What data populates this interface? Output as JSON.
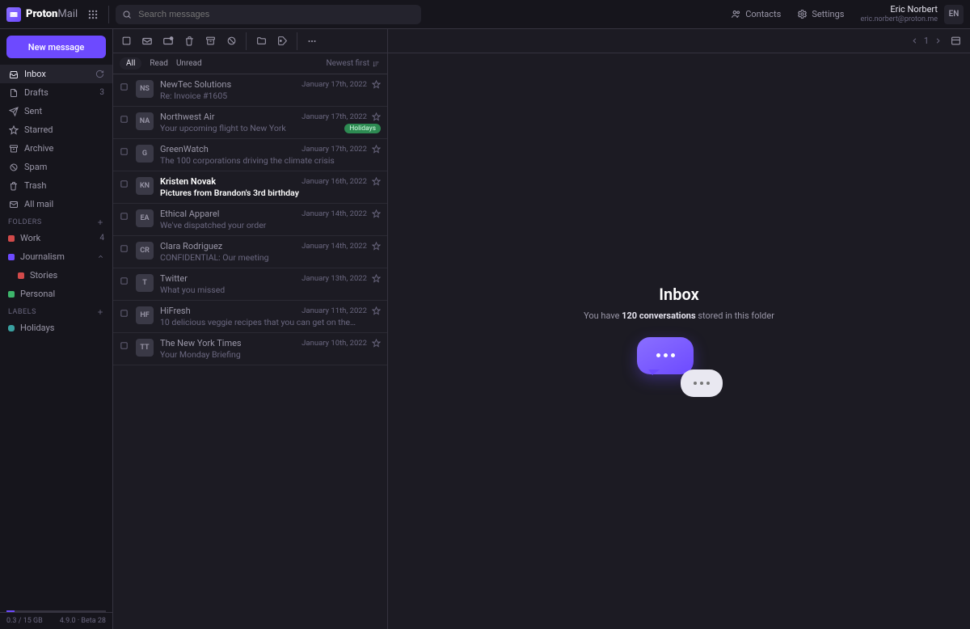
{
  "brand": {
    "name_bold": "Proton",
    "name_light": "Mail"
  },
  "search": {
    "placeholder": "Search messages"
  },
  "top_links": {
    "contacts": "Contacts",
    "settings": "Settings"
  },
  "user": {
    "name": "Eric Norbert",
    "email": "eric.norbert@proton.me",
    "initials": "EN"
  },
  "compose_label": "New message",
  "nav": [
    {
      "icon": "inbox",
      "label": "Inbox",
      "active": true,
      "badge": ""
    },
    {
      "icon": "file",
      "label": "Drafts",
      "badge": "3"
    },
    {
      "icon": "send",
      "label": "Sent"
    },
    {
      "icon": "star",
      "label": "Starred"
    },
    {
      "icon": "archive",
      "label": "Archive"
    },
    {
      "icon": "spam",
      "label": "Spam"
    },
    {
      "icon": "trash",
      "label": "Trash"
    },
    {
      "icon": "mail",
      "label": "All mail"
    }
  ],
  "folders_header": "Folders",
  "folders": [
    {
      "label": "Work",
      "color": "#d14a4a",
      "count": "4"
    },
    {
      "label": "Journalism",
      "color": "#6d4aff",
      "expandable": true
    },
    {
      "label": "Stories",
      "color": "#d14a4a",
      "child": true
    },
    {
      "label": "Personal",
      "color": "#3db56b"
    }
  ],
  "labels_header": "Labels",
  "labels": [
    {
      "label": "Holidays",
      "color": "#39a0a0"
    }
  ],
  "storage": {
    "used": "0.3",
    "total": "15 GB",
    "version": "4.9.0 · Beta 28"
  },
  "filters": {
    "all": "All",
    "read": "Read",
    "unread": "Unread",
    "sort": "Newest first"
  },
  "pagination": {
    "page": "1"
  },
  "pane": {
    "title": "Inbox",
    "sub_pre": "You have ",
    "count": "120 conversations",
    "sub_post": " stored in this folder"
  },
  "messages": [
    {
      "initials": "NS",
      "from": "NewTec Solutions",
      "subject": "Re: Invoice #1605",
      "date": "January 17th, 2022",
      "unread": false
    },
    {
      "initials": "NA",
      "from": "Northwest Air",
      "subject": "Your upcoming flight to New York",
      "date": "January 17th, 2022",
      "unread": false,
      "tag": "Holidays"
    },
    {
      "initials": "G",
      "from": "GreenWatch",
      "subject": "The 100 corporations driving the climate crisis",
      "date": "January 17th, 2022",
      "unread": false
    },
    {
      "initials": "KN",
      "from": "Kristen Novak",
      "subject": "Pictures from Brandon's 3rd birthday",
      "date": "January 16th, 2022",
      "unread": true
    },
    {
      "initials": "EA",
      "from": "Ethical Apparel",
      "subject": "We've dispatched your order",
      "date": "January 14th, 2022",
      "unread": false
    },
    {
      "initials": "CR",
      "from": "Clara Rodriguez",
      "subject": "CONFIDENTIAL: Our meeting",
      "date": "January 14th, 2022",
      "unread": false
    },
    {
      "initials": "T",
      "from": "Twitter",
      "subject": "What you missed",
      "date": "January 13th, 2022",
      "unread": false
    },
    {
      "initials": "HF",
      "from": "HiFresh",
      "subject": "10 delicious veggie recipes that you can get on the…",
      "date": "January 11th, 2022",
      "unread": false
    },
    {
      "initials": "TT",
      "from": "The New York Times",
      "subject": "Your Monday Briefing",
      "date": "January 10th, 2022",
      "unread": false
    }
  ]
}
